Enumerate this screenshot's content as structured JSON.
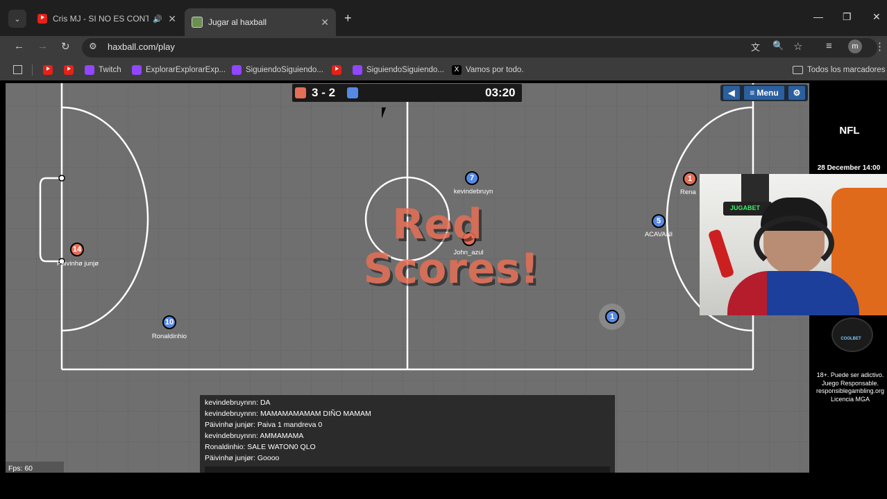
{
  "browser": {
    "tabs": [
      {
        "title": "Cris MJ - SI NO ES CONTIGO",
        "active": false
      },
      {
        "title": "Jugar al haxball",
        "active": true
      }
    ],
    "url": "haxball.com/play",
    "profile_initial": "m",
    "bookmarks": [
      {
        "label": "",
        "icon": "youtube-icon"
      },
      {
        "label": "",
        "icon": "youtube-icon"
      },
      {
        "label": "Twitch",
        "icon": "twitch-icon"
      },
      {
        "label": "ExplorarExplorarExp...",
        "icon": "twitch-icon"
      },
      {
        "label": "SiguiendoSiguiendo...",
        "icon": "twitch-icon"
      },
      {
        "label": "",
        "icon": "youtube-icon"
      },
      {
        "label": "SiguiendoSiguiendo...",
        "icon": "twitch-icon"
      },
      {
        "label": "Vamos por todo.",
        "icon": "x-icon"
      }
    ],
    "all_bookmarks_label": "Todos los marcadores"
  },
  "game": {
    "red_score": "3",
    "separator": "-",
    "blue_score": "2",
    "time": "03:20",
    "menu_label": "Menu",
    "banner_line1": "Red",
    "banner_line2": "Scores!",
    "fps": "Fps: 60",
    "colors": {
      "red": "#e56e56",
      "blue": "#5689e5",
      "field": "#6f6f6f"
    },
    "players": [
      {
        "number": "7",
        "team": "blue",
        "name": "kevindebruyn"
      },
      {
        "number": "",
        "team": "red",
        "name": "John_azul"
      },
      {
        "number": "14",
        "team": "red",
        "name": "Päivinhø junjø"
      },
      {
        "number": "10",
        "team": "blue",
        "name": "Ronaldinhio"
      },
      {
        "number": "5",
        "team": "blue",
        "name": "ACAVANI"
      },
      {
        "number": "1",
        "team": "red",
        "name": "Rena"
      },
      {
        "number": "1",
        "team": "blue",
        "name": ""
      }
    ],
    "chat": [
      "kevindebruynnn: DA",
      "kevindebruynnn: MAMAMAMAMAM DIÑO MAMAM",
      "Päivinhø junjør: Paiva 1 mandreva 0",
      "kevindebruynnn: AMMAMAMA",
      "Ronaldinhio: SALE WATON0 QLO",
      "Päivinhø junjør: Goooo"
    ]
  },
  "ad": {
    "brand_top": "NFL",
    "date": "28 December 14:00",
    "logo_text": "COOLBET",
    "disclaimer": "18+. Puede ser adictivo. Juego Responsable. responsiblegambling.org Licencia MGA"
  },
  "webcam": {
    "sign_text": "JUGABET"
  }
}
